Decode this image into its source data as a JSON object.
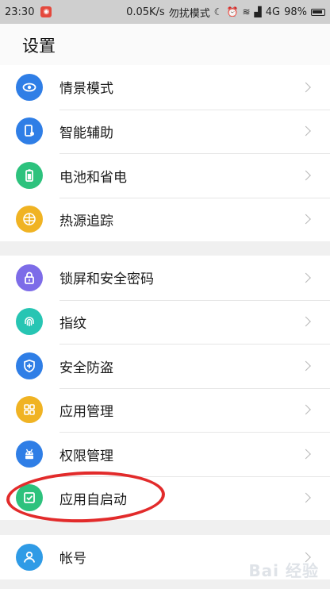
{
  "status_bar": {
    "time": "23:30",
    "speed": "0.05K/s",
    "dnd": "勿扰模式",
    "network": "4G",
    "battery": "98%"
  },
  "header": {
    "title": "设置"
  },
  "groups": [
    {
      "items": [
        {
          "label": "情景模式",
          "icon": "eye-icon",
          "color": "#2f7ee6"
        },
        {
          "label": "智能辅助",
          "icon": "phone-hand-icon",
          "color": "#2f7ee6"
        },
        {
          "label": "电池和省电",
          "icon": "battery-icon",
          "color": "#2dc27d"
        },
        {
          "label": "热源追踪",
          "icon": "heat-icon",
          "color": "#f0b323"
        }
      ]
    },
    {
      "items": [
        {
          "label": "锁屏和安全密码",
          "icon": "lock-icon",
          "color": "#7d6ce8"
        },
        {
          "label": "指纹",
          "icon": "fingerprint-icon",
          "color": "#27c5b3"
        },
        {
          "label": "安全防盗",
          "icon": "shield-icon",
          "color": "#2f7ee6"
        },
        {
          "label": "应用管理",
          "icon": "apps-grid-icon",
          "color": "#f0b323"
        },
        {
          "label": "权限管理",
          "icon": "android-icon",
          "color": "#2f7ee6"
        },
        {
          "label": "应用自启动",
          "icon": "autostart-icon",
          "color": "#2dc27d"
        }
      ]
    },
    {
      "items": [
        {
          "label": "帐号",
          "icon": "account-icon",
          "color": "#2f9be6"
        }
      ]
    }
  ],
  "watermark": "Bai 经验"
}
